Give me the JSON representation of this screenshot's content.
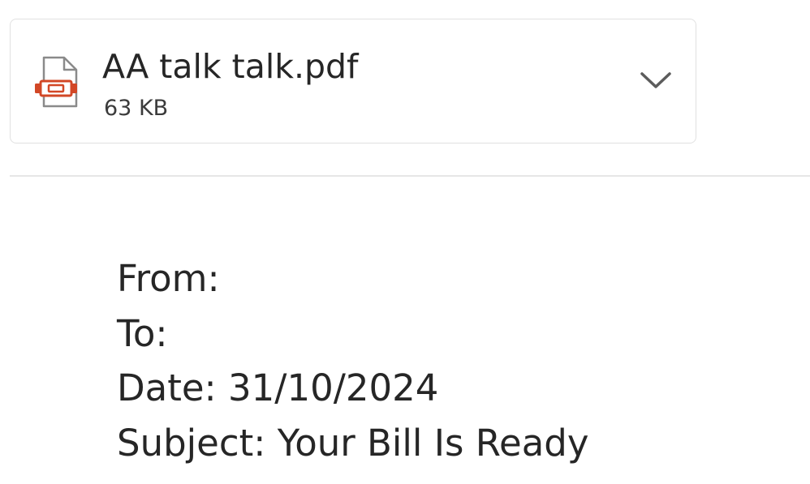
{
  "attachment": {
    "file_name": "AA talk talk.pdf",
    "file_size": "63 KB",
    "file_icon": "pdf-file-icon",
    "expand_icon": "chevron-down-icon",
    "icon_accent_color": "#d24726"
  },
  "email_header": {
    "from_line": "From:",
    "to_line": "To:",
    "date_line": "Date: 31/10/2024",
    "subject_line": "Subject: Your Bill Is Ready"
  }
}
